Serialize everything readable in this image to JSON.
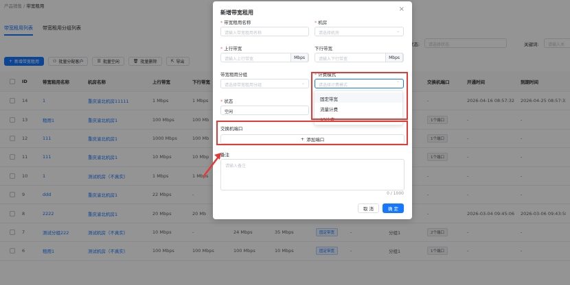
{
  "breadcrumb": {
    "root": "产品销售",
    "sep": "/",
    "current": "带宽租用"
  },
  "tabs": [
    "带宽租用列表",
    "带宽租用分组列表"
  ],
  "filters": {
    "status_label": "状态:",
    "status_placeholder": "请选择状态",
    "keyword_label": "关键词:",
    "keyword_placeholder": "请输入关"
  },
  "toolbar": {
    "add": "新增带宽租用",
    "assign": "批量分配客户",
    "clear": "批量空闲",
    "delete": "批量删除",
    "export": "导出"
  },
  "table": {
    "headers": [
      "ID",
      "带宽租用名称",
      "机房名称",
      "上行带宽",
      "下行带宽",
      "",
      "",
      "",
      "",
      "组",
      "交换机端口",
      "开通时间",
      "到期时间"
    ],
    "rows": [
      {
        "id": "14",
        "name": "1",
        "room": "重庆渝北机房11111",
        "up": "1 Mbps",
        "down": "1 Mbps",
        "c6": "",
        "c7": "",
        "tag": "",
        "c9": "",
        "group": "",
        "port": "-",
        "open": "2026-04-16 08:57:32",
        "expire": "2026-04-25 08:57:33"
      },
      {
        "id": "13",
        "name": "租用1",
        "room": "重庆渝北机房1",
        "up": "100 Mbps",
        "down": "100 Mb",
        "c6": "",
        "c7": "",
        "tag": "",
        "c9": "",
        "group": "",
        "port": "1个端口",
        "open": "-",
        "expire": "-"
      },
      {
        "id": "12",
        "name": "111",
        "room": "重庆渝北机房1",
        "up": "1000 Mbps",
        "down": "100 Mb",
        "c6": "",
        "c7": "",
        "tag": "",
        "c9": "",
        "group": "",
        "port": "1个端口",
        "open": "-",
        "expire": "-"
      },
      {
        "id": "11",
        "name": "111",
        "room": "重庆渝北机房1",
        "up": "10 Mbps",
        "down": "10 Mbp",
        "c6": "",
        "c7": "",
        "tag": "",
        "c9": "",
        "group": "",
        "port": "1个端口",
        "open": "-",
        "expire": "-"
      },
      {
        "id": "10",
        "name": "1",
        "room": "测试机房（不真实）",
        "up": "1 Mbps",
        "down": "1 Mbps",
        "c6": "",
        "c7": "",
        "tag": "",
        "c9": "",
        "group": "",
        "port": "-",
        "open": "-",
        "expire": "-"
      },
      {
        "id": "9",
        "name": "ddd",
        "room": "重庆渝北机房1",
        "up": "22 Mbps",
        "down": "-",
        "c6": "",
        "c7": "",
        "tag": "",
        "c9": "",
        "group": "",
        "port": "-",
        "open": "-",
        "expire": "-"
      },
      {
        "id": "8",
        "name": "2222",
        "room": "重庆渝北机房1",
        "up": "20 Mbps",
        "down": "20 Mb",
        "c6": "",
        "c7": "",
        "tag": "",
        "c9": "",
        "group": "",
        "port": "-",
        "open": "2026-03-04 09:45:06",
        "expire": "2026-03-06 09:43:58"
      },
      {
        "id": "7",
        "name": "测试分组222",
        "room": "测试机房（不真实）",
        "up": "10 Mbps",
        "down": "-",
        "c6": "24 Mbps",
        "c7": "35 Mbps",
        "tag": "固定带宽",
        "c9": "-",
        "group": "分组1",
        "port": "2个端口",
        "open": "-",
        "expire": "-"
      },
      {
        "id": "6",
        "name": "租用1",
        "room": "测试机房（不真实）",
        "up": "100 Mbps",
        "down": "100 Mbps",
        "c6": "100 Mbps",
        "c7": "10 Mbps",
        "tag": "固定带宽",
        "c9": "-",
        "group": "分组1",
        "port": "1个端口",
        "open": "-",
        "expire": "-"
      }
    ]
  },
  "modal": {
    "title": "新增带宽租用",
    "name_label": "带宽租用名称",
    "name_placeholder": "请输入带宽租用名称",
    "room_label": "机房",
    "room_placeholder": "请选择机房",
    "up_label": "上行带宽",
    "up_placeholder": "请输入上行带宽",
    "down_label": "下行带宽",
    "down_placeholder": "请输入下行带宽",
    "unit": "Mbps",
    "group_label": "带宽租用分组",
    "group_placeholder": "请选择带宽租用分组",
    "billing_label": "计费模式",
    "billing_placeholder": "请选择计费模式",
    "billing_options": [
      "固定带宽",
      "流量计费",
      "95计费"
    ],
    "status_label": "状态",
    "status_value": "空闲",
    "port_label": "交换机端口",
    "add_port": "添加端口",
    "remark_label": "备注",
    "remark_placeholder": "请输入备注",
    "remark_count": "0 / 1000",
    "cancel": "取 消",
    "confirm": "确 定"
  },
  "colors": {
    "primary": "#1677ff",
    "highlight": "#e53935"
  }
}
